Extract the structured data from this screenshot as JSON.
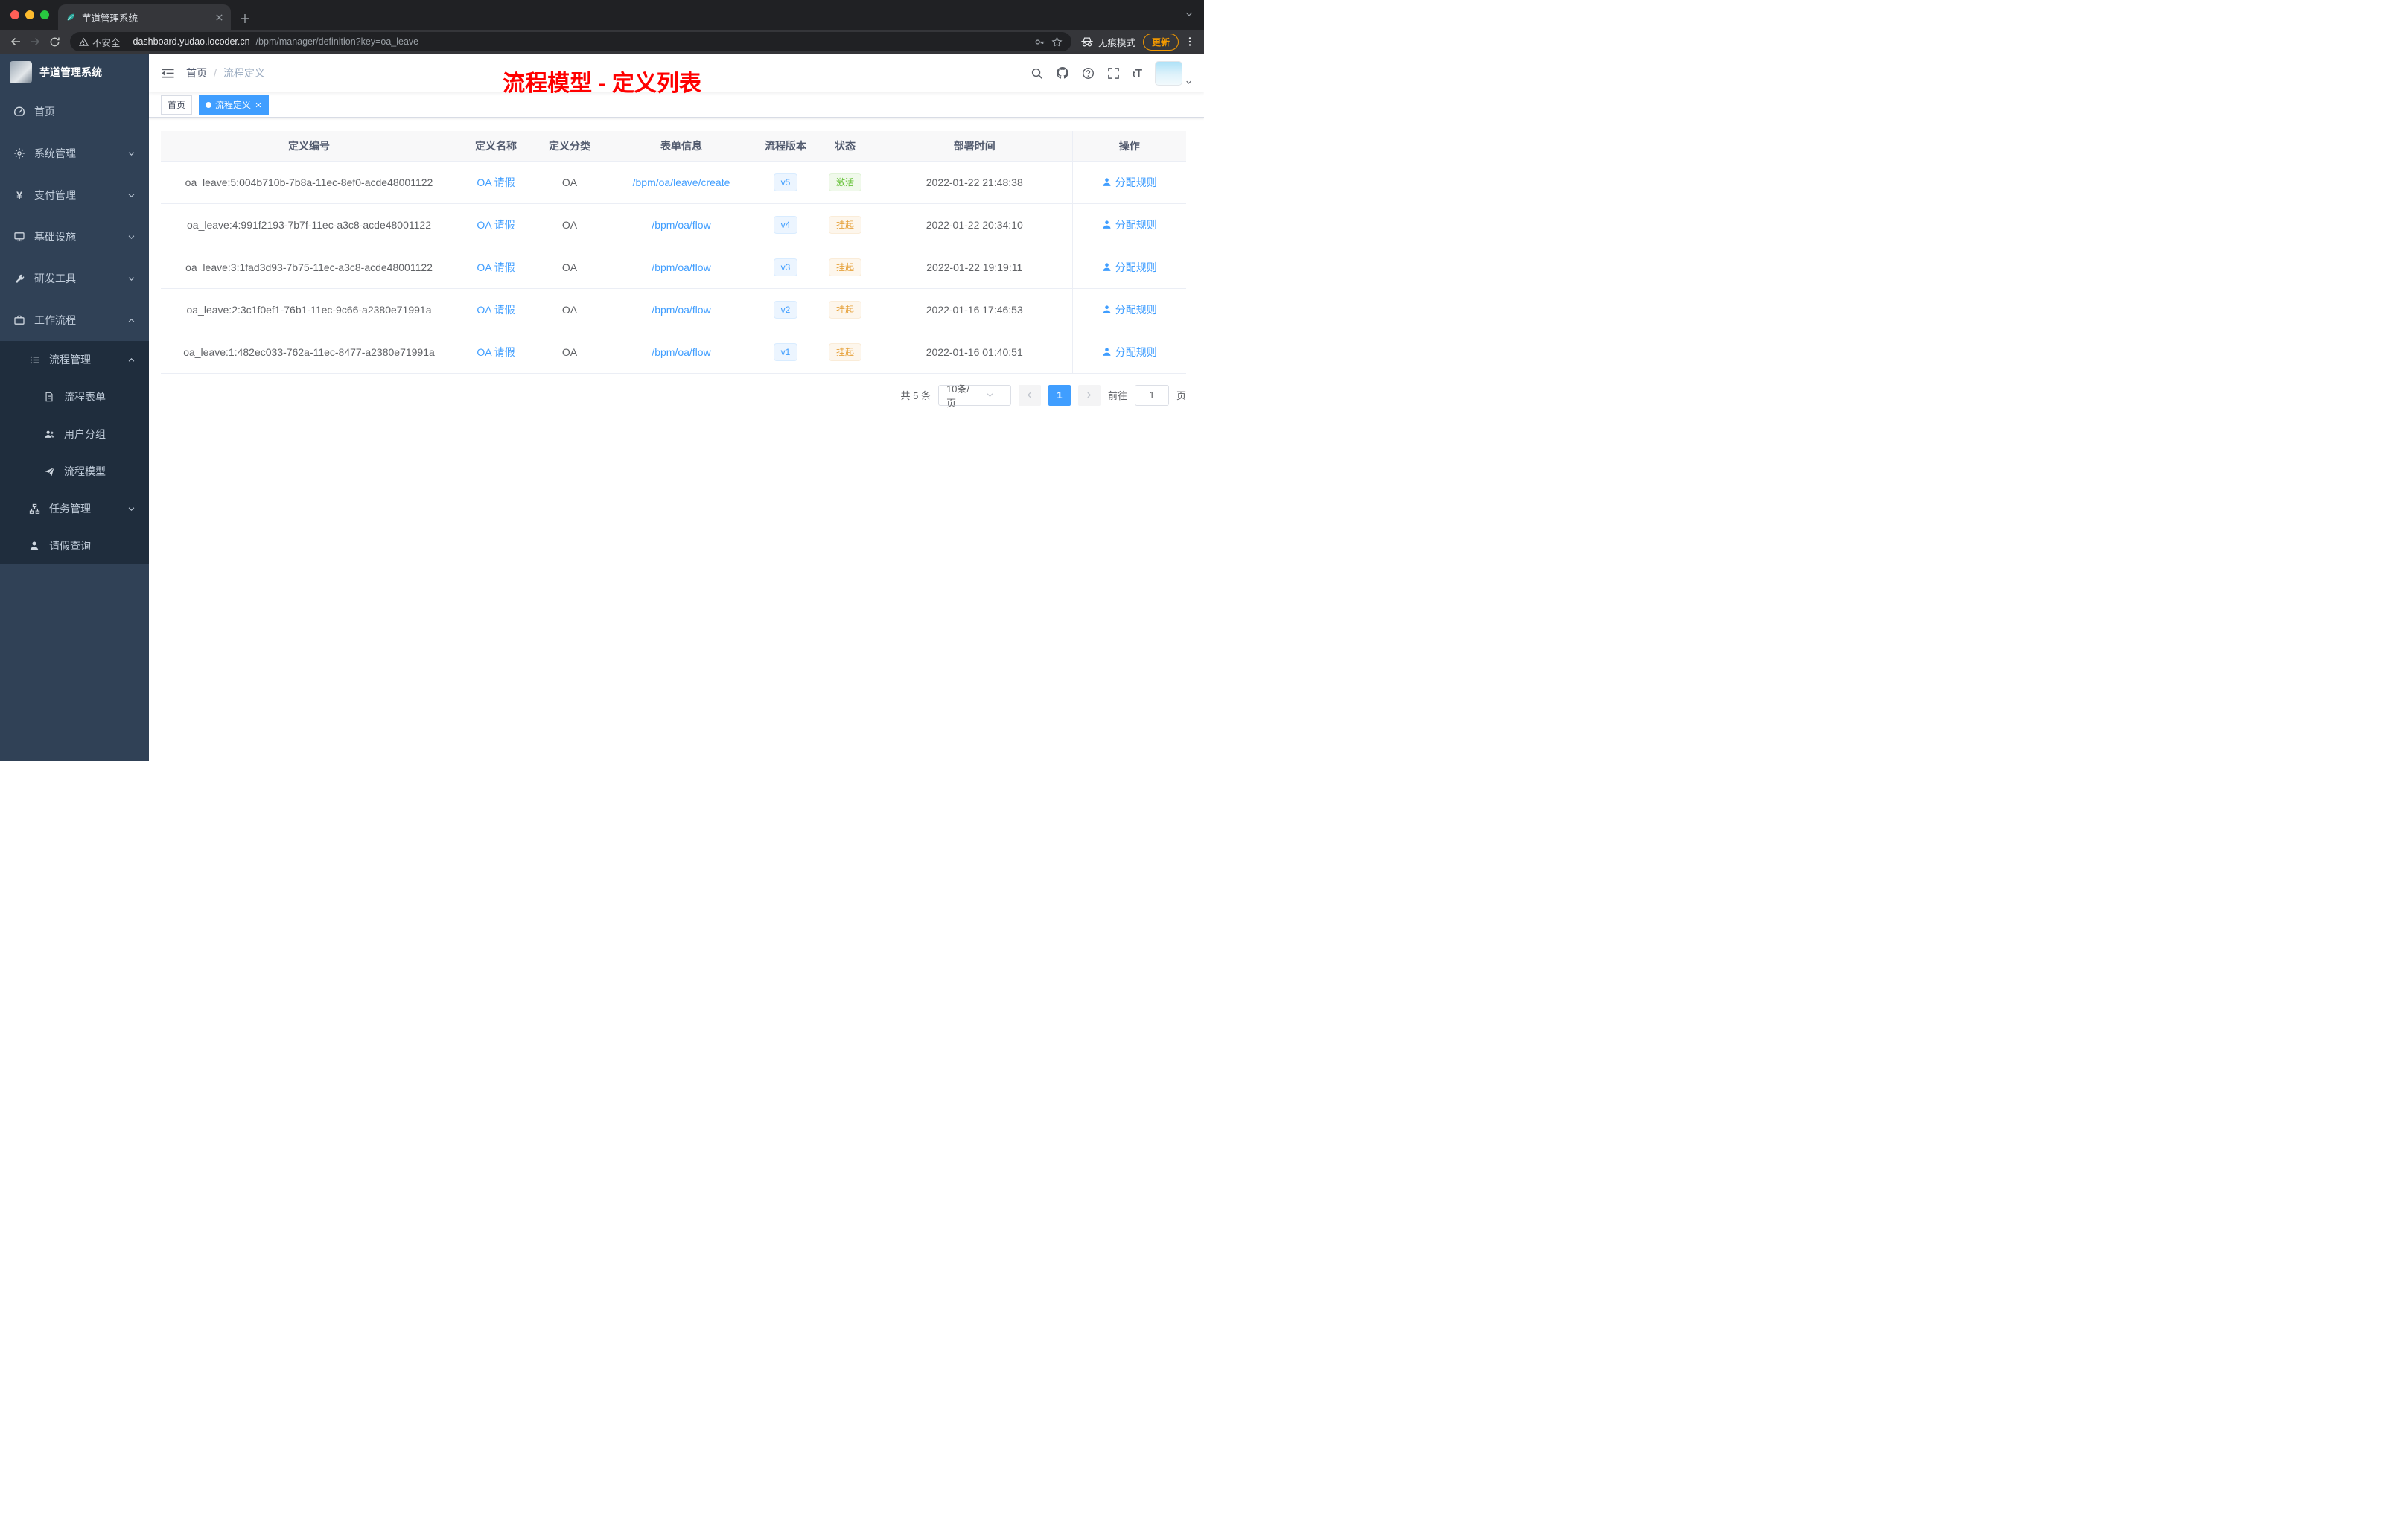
{
  "colors": {
    "accent": "#409eff",
    "success": "#67c23a",
    "warning": "#e6a23c",
    "annotation_red": "#ff0000",
    "sidebar_bg": "#304156",
    "submenu_bg": "#1f2d3d"
  },
  "browser": {
    "tab_title": "芋道管理系统",
    "security_label": "不安全",
    "url_host": "dashboard.yudao.iocoder.cn",
    "url_path": "/bpm/manager/definition?key=oa_leave",
    "incognito_label": "无痕模式",
    "update_label": "更新"
  },
  "sidebar": {
    "logo_title": "芋道管理系统",
    "items": [
      {
        "label": "首页"
      },
      {
        "label": "系统管理"
      },
      {
        "label": "支付管理"
      },
      {
        "label": "基础设施"
      },
      {
        "label": "研发工具"
      },
      {
        "label": "工作流程"
      },
      {
        "label": "流程管理"
      },
      {
        "label": "流程表单"
      },
      {
        "label": "用户分组"
      },
      {
        "label": "流程模型"
      },
      {
        "label": "任务管理"
      },
      {
        "label": "请假查询"
      }
    ]
  },
  "navbar": {
    "breadcrumb": {
      "home": "首页",
      "separator": "/",
      "current": "流程定义"
    },
    "annotation": "流程模型 - 定义列表"
  },
  "tags": {
    "home": "首页",
    "active": "流程定义"
  },
  "table": {
    "columns": {
      "id": "定义编号",
      "name": "定义名称",
      "category": "定义分类",
      "form": "表单信息",
      "version": "流程版本",
      "status": "状态",
      "deploy_time": "部署时间",
      "actions": "操作"
    },
    "rows": [
      {
        "id": "oa_leave:5:004b710b-7b8a-11ec-8ef0-acde48001122",
        "name": "OA 请假",
        "category": "OA",
        "form": "/bpm/oa/leave/create",
        "version": "v5",
        "status": "激活",
        "status_type": "success",
        "deploy_time": "2022-01-22 21:48:38",
        "action": "分配规则"
      },
      {
        "id": "oa_leave:4:991f2193-7b7f-11ec-a3c8-acde48001122",
        "name": "OA 请假",
        "category": "OA",
        "form": "/bpm/oa/flow",
        "version": "v4",
        "status": "挂起",
        "status_type": "warning",
        "deploy_time": "2022-01-22 20:34:10",
        "action": "分配规则"
      },
      {
        "id": "oa_leave:3:1fad3d93-7b75-11ec-a3c8-acde48001122",
        "name": "OA 请假",
        "category": "OA",
        "form": "/bpm/oa/flow",
        "version": "v3",
        "status": "挂起",
        "status_type": "warning",
        "deploy_time": "2022-01-22 19:19:11",
        "action": "分配规则"
      },
      {
        "id": "oa_leave:2:3c1f0ef1-76b1-11ec-9c66-a2380e71991a",
        "name": "OA 请假",
        "category": "OA",
        "form": "/bpm/oa/flow",
        "version": "v2",
        "status": "挂起",
        "status_type": "warning",
        "deploy_time": "2022-01-16 17:46:53",
        "action": "分配规则"
      },
      {
        "id": "oa_leave:1:482ec033-762a-11ec-8477-a2380e71991a",
        "name": "OA 请假",
        "category": "OA",
        "form": "/bpm/oa/flow",
        "version": "v1",
        "status": "挂起",
        "status_type": "warning",
        "deploy_time": "2022-01-16 01:40:51",
        "action": "分配规则"
      }
    ]
  },
  "pagination": {
    "total": "共 5 条",
    "page_size": "10条/页",
    "page": "1",
    "goto_label": "前往",
    "goto_value": "1",
    "unit_label": "页"
  }
}
